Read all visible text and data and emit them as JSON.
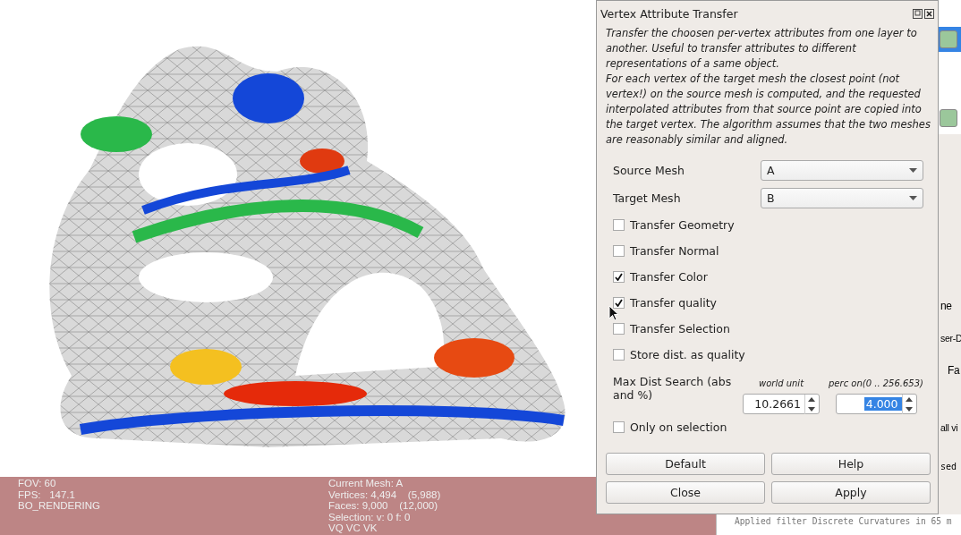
{
  "viewport": {
    "info_left": [
      "FOV: 60",
      "FPS:   147.1",
      "BO_RENDERING"
    ],
    "info_right": [
      "Current Mesh: A",
      "Vertices: 4,494    (5,988)",
      "Faces: 9,000    (12,000)",
      "Selection: v: 0 f: 0",
      "VQ VC VK"
    ]
  },
  "layer_panel": {
    "fragments": [
      "ne",
      "ser-D",
      "Fa",
      "all vi",
      "sed"
    ],
    "log": "Applied filter Discrete Curvatures in 65 m"
  },
  "dialog": {
    "title": "Vertex Attribute Transfer",
    "description": [
      "Transfer the choosen per-vertex attributes from one layer to another. Useful to transfer attributes to different representations of a same object.",
      "For each vertex of the target mesh the closest point (not vertex!) on the source mesh is computed, and the requested interpolated attributes from that source point are copied into the target vertex. The algorithm assumes that the two meshes are reasonably similar and aligned."
    ],
    "selects": [
      {
        "label": "Source Mesh",
        "value": "A"
      },
      {
        "label": "Target Mesh",
        "value": "B"
      }
    ],
    "options": [
      {
        "label": "Transfer Geometry",
        "checked": false
      },
      {
        "label": "Transfer Normal",
        "checked": false
      },
      {
        "label": "Transfer Color",
        "checked": true
      },
      {
        "label": "Transfer quality",
        "checked": true
      },
      {
        "label": "Transfer Selection",
        "checked": false
      },
      {
        "label": "Store dist. as quality",
        "checked": false
      }
    ],
    "max_dist": {
      "label": "Max Dist Search (abs and %)",
      "world_unit_label": "world unit",
      "world_unit_value": "10.2661",
      "percent_label": "perc on(0 .. 256.653)",
      "percent_value": "4.000",
      "percent_value_selected": true
    },
    "only_on_selection": {
      "label": "Only on selection",
      "checked": false
    },
    "buttons": [
      "Default",
      "Help",
      "Close",
      "Apply"
    ]
  }
}
